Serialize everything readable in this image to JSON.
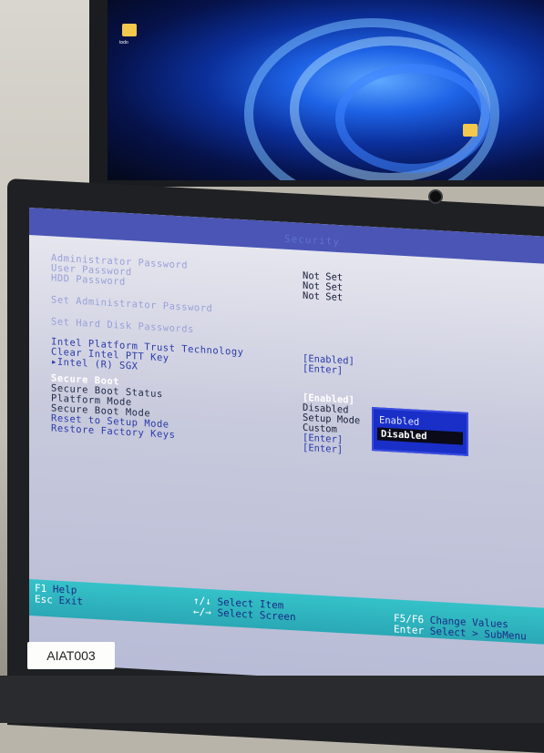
{
  "photo": {
    "sticker_label": "AIAT003"
  },
  "desktop": {
    "icon_label": "todo"
  },
  "bios": {
    "tab": "Security",
    "rows": [
      {
        "label": "Administrator Password",
        "value": "Not Set"
      },
      {
        "label": "User Password",
        "value": "Not Set"
      },
      {
        "label": "HDD Password",
        "value": "Not Set"
      },
      {
        "label": "Set Administrator Password",
        "value": ""
      },
      {
        "label": "Set Hard Disk Passwords",
        "value": ""
      },
      {
        "label": "Intel Platform Trust Technology",
        "value": "[Enabled]"
      },
      {
        "label": "Clear Intel PTT Key",
        "value": "[Enter]"
      },
      {
        "label": "▸Intel (R) SGX",
        "value": ""
      },
      {
        "label": "Secure Boot",
        "value": ""
      },
      {
        "label": "Secure Boot Status",
        "value": "[Enabled]"
      },
      {
        "label": "Platform Mode",
        "value": "Disabled"
      },
      {
        "label": "Secure Boot Mode",
        "value": "Setup Mode"
      },
      {
        "label": "Reset to Setup Mode",
        "value": "Custom"
      },
      {
        "label": "Restore Factory Keys",
        "value": "[Enter]"
      },
      {
        "label": "",
        "value": "[Enter]"
      }
    ],
    "popup": {
      "option1": "Enabled",
      "option2": "Disabled"
    },
    "footer": {
      "f1_key": "F1",
      "f1_text": "Help",
      "esc_key": "Esc",
      "esc_text": "Exit",
      "ud_key": "↑/↓",
      "ud_text": "Select Item",
      "lr_key": "←/→",
      "lr_text": "Select Screen",
      "f5_key": "F5/F6",
      "f5_text": "Change Values",
      "enter_key": "Enter",
      "enter_text": "Select > SubMenu"
    }
  }
}
